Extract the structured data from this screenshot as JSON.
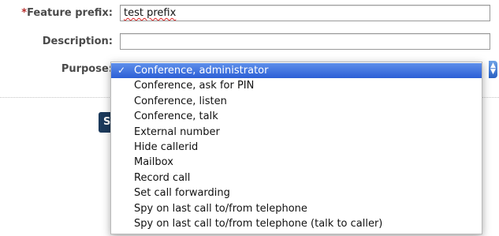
{
  "form": {
    "feature_prefix": {
      "required_mark": "*",
      "label": "Feature prefix:",
      "value": "test prefix"
    },
    "description": {
      "label": "Description:",
      "value": ""
    },
    "purpose": {
      "label": "Purpose:",
      "selected": "Conference, administrator"
    },
    "save_label": "Save"
  },
  "dropdown": {
    "check_glyph": "✓",
    "options": [
      "Conference, administrator",
      "Conference, ask for PIN",
      "Conference, listen",
      "Conference, talk",
      "External number",
      "Hide callerid",
      "Mailbox",
      "Record call",
      "Set call forwarding",
      "Spy on last call to/from telephone",
      "Spy on last call to/from telephone (talk to caller)"
    ],
    "selected_index": 0
  },
  "colors": {
    "required": "#b8312f",
    "highlight": "#3a6fd9",
    "button": "#1c3a5c"
  }
}
